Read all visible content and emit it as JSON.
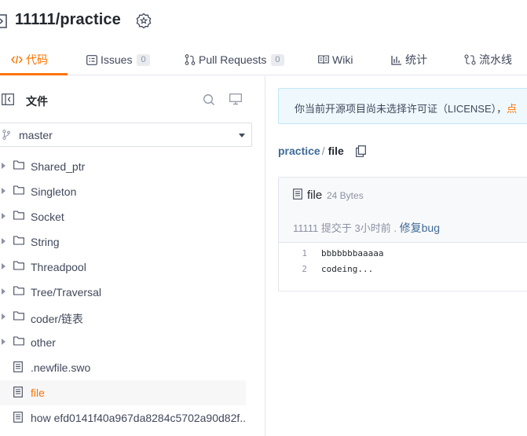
{
  "repo": {
    "title": "11111/practice"
  },
  "tabs": [
    {
      "label": "代码",
      "icon": "code-icon",
      "active": true
    },
    {
      "label": "Issues",
      "icon": "issues-icon",
      "count": "0"
    },
    {
      "label": "Pull Requests",
      "icon": "pull-request-icon",
      "count": "0"
    },
    {
      "label": "Wiki",
      "icon": "wiki-icon"
    },
    {
      "label": "统计",
      "icon": "chart-icon"
    },
    {
      "label": "流水线",
      "icon": "pipeline-icon"
    }
  ],
  "sidebar": {
    "title": "文件",
    "branch": "master",
    "items": [
      {
        "label": "Shared_ptr",
        "type": "folder"
      },
      {
        "label": "Singleton",
        "type": "folder"
      },
      {
        "label": "Socket",
        "type": "folder"
      },
      {
        "label": "String",
        "type": "folder"
      },
      {
        "label": "Threadpool",
        "type": "folder"
      },
      {
        "label": "Tree/Traversal",
        "type": "folder"
      },
      {
        "label": "coder/链表",
        "type": "folder"
      },
      {
        "label": "other",
        "type": "folder"
      },
      {
        "label": ".newfile.swo",
        "type": "file"
      },
      {
        "label": "file",
        "type": "file",
        "active": true
      },
      {
        "label": "how efd0141f40a967da8284c5702a90d82f...",
        "type": "file"
      }
    ]
  },
  "main": {
    "license_text": "你当前开源项目尚未选择许可证（LICENSE），",
    "license_link": "点",
    "breadcrumb": {
      "repo": "practice",
      "sep": "/",
      "file": "file"
    },
    "file": {
      "name": "file",
      "size": "24 Bytes",
      "commit_author": "11111",
      "commit_text": "提交于 3小时前 .",
      "commit_message": "修复bug"
    },
    "code": [
      {
        "n": "1",
        "text": "bbbbbbbaaaaa"
      },
      {
        "n": "2",
        "text": "codeing..."
      }
    ]
  },
  "colors": {
    "accent": "#fe7300",
    "link": "#3f6b99",
    "muted": "#8c92a4"
  }
}
